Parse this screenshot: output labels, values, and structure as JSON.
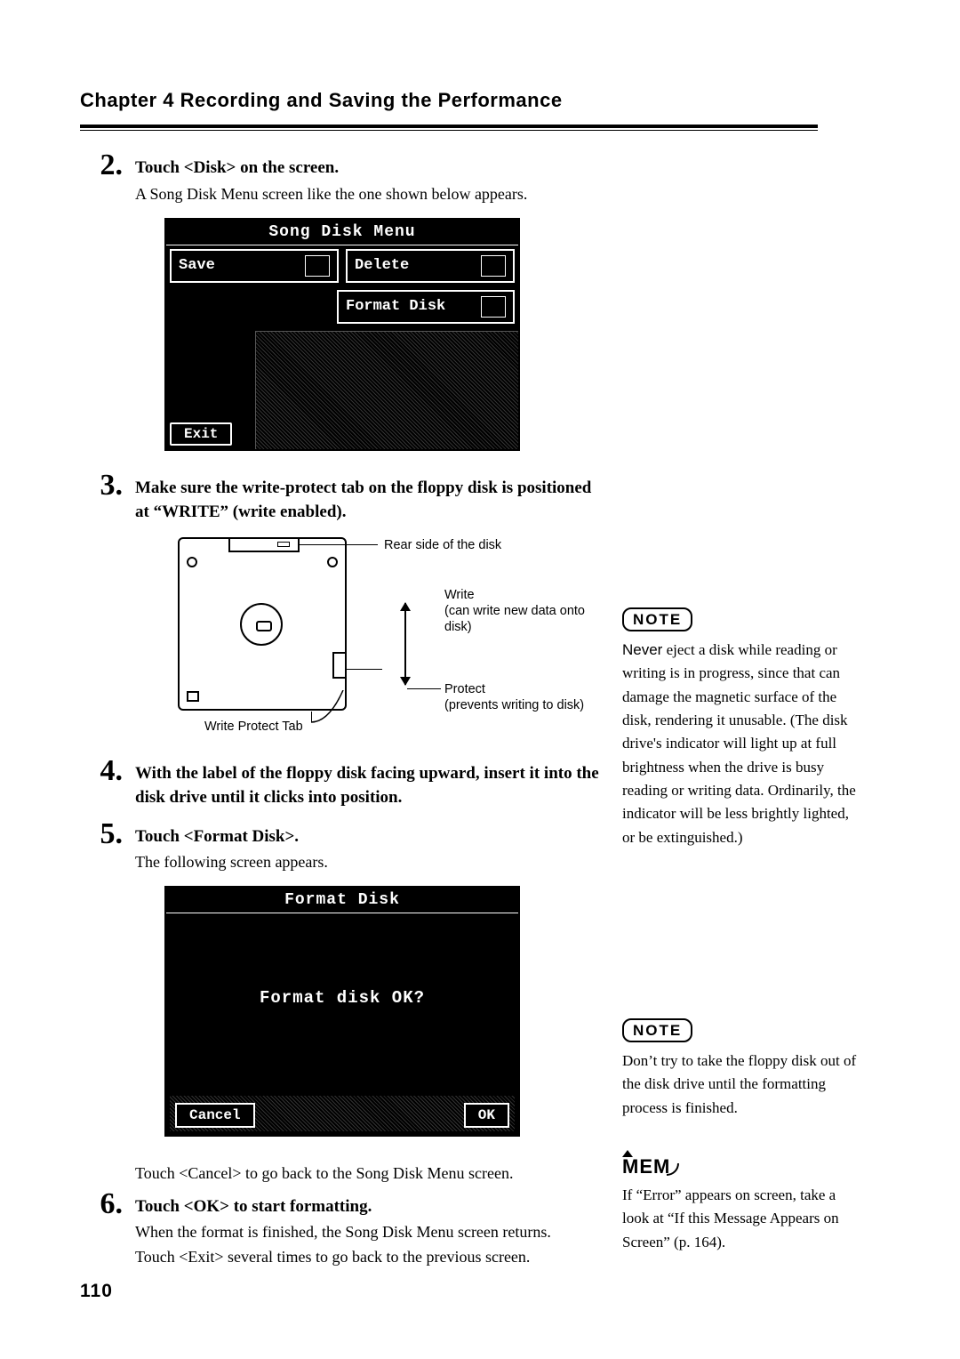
{
  "chapter_title": "Chapter 4  Recording and Saving the Performance",
  "step2": {
    "num": "2.",
    "head": "Touch <Disk> on the screen.",
    "text": "A Song Disk Menu screen like the one shown below appears."
  },
  "lcd1": {
    "title": "Song Disk Menu",
    "save": "Save",
    "delete": "Delete",
    "format": "Format Disk",
    "exit": "Exit"
  },
  "step3": {
    "num": "3.",
    "head": "Make sure the write-protect tab on the floppy disk is positioned at “WRITE” (write enabled)."
  },
  "diagram": {
    "rear": "Rear side of the disk",
    "write": "Write",
    "write_sub": "(can write new data onto disk)",
    "wp_tab": "Write Protect Tab",
    "protect": "Protect",
    "protect_sub": "(prevents writing to disk)"
  },
  "step4": {
    "num": "4.",
    "head": "With the label of the floppy disk facing upward, insert it into the disk drive until it clicks into position."
  },
  "step5": {
    "num": "5.",
    "head": "Touch <Format Disk>.",
    "text": "The following screen appears."
  },
  "lcd2": {
    "title": "Format Disk",
    "msg": "Format disk OK?",
    "cancel": "Cancel",
    "ok": "OK"
  },
  "after_lcd2": "Touch <Cancel> to go back to the Song Disk Menu screen.",
  "step6": {
    "num": "6.",
    "head": "Touch <OK> to start formatting.",
    "text1": "When the format is finished, the Song Disk Menu screen returns.",
    "text2": "Touch <Exit> several times to go back to the previous screen."
  },
  "note1": {
    "badge": "NOTE",
    "prefix": "Never",
    "body": " eject a disk while reading or writing is in progress, since that can damage the magnetic surface of the disk, rendering it unusable. (The disk drive's indicator will light up at full brightness when the drive is busy reading or writing data. Ordinarily, the indicator will be less brightly lighted, or be extinguished.)"
  },
  "note2": {
    "badge": "NOTE",
    "body": "Don’t try to take the floppy disk out of the disk drive until the formatting process is finished."
  },
  "memo": {
    "badge": "MEM",
    "body": "If “Error” appears on screen, take a look at “If this Message Appears on Screen” (p. 164)."
  },
  "page_number": "110"
}
